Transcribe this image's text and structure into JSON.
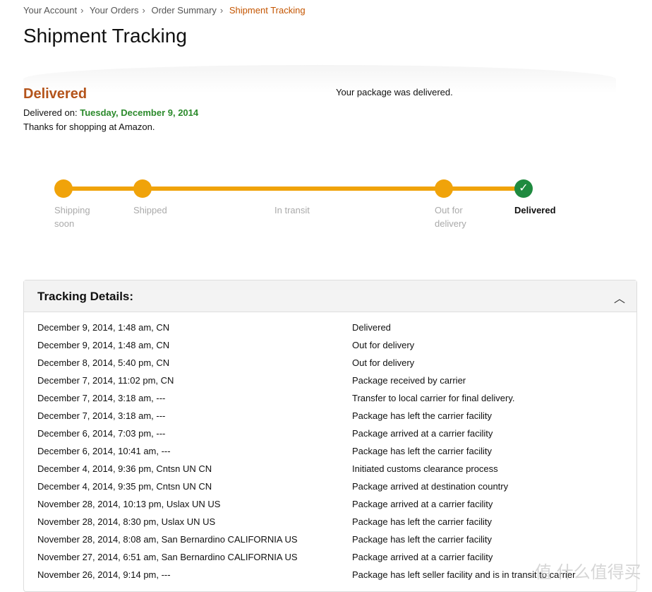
{
  "breadcrumb": [
    "Your Account",
    "Your Orders",
    "Order Summary",
    "Shipment Tracking"
  ],
  "title": "Shipment Tracking",
  "status": {
    "heading": "Delivered",
    "delivered_on_label": "Delivered on:",
    "delivered_date": "Tuesday, December 9, 2014",
    "thanks": "Thanks for shopping at Amazon.",
    "message": "Your package was delivered."
  },
  "progress": {
    "steps": [
      {
        "label": "Shipping soon",
        "dot": true,
        "current": false
      },
      {
        "label": "Shipped",
        "dot": true,
        "current": false
      },
      {
        "label": "In transit",
        "dot": false,
        "current": false
      },
      {
        "label": "Out for delivery",
        "dot": true,
        "current": false
      },
      {
        "label": "Delivered",
        "dot": true,
        "current": true
      }
    ],
    "color": "#f0a30a",
    "done_color": "#1f8a3f"
  },
  "tracking": {
    "title": "Tracking Details:",
    "rows": [
      [
        "December 9, 2014, 1:48 am,   CN",
        "Delivered"
      ],
      [
        "December 9, 2014, 1:48 am,   CN",
        "Out for delivery"
      ],
      [
        "December 8, 2014, 5:40 pm,   CN",
        "Out for delivery"
      ],
      [
        "December 7, 2014, 11:02 pm,   CN",
        "Package received by carrier"
      ],
      [
        "December 7, 2014, 3:18 am, ---",
        "Transfer to local carrier for final delivery."
      ],
      [
        "December 7, 2014, 3:18 am, ---",
        "Package has left the carrier facility"
      ],
      [
        "December 6, 2014, 7:03 pm, ---",
        "Package arrived at a carrier facility"
      ],
      [
        "December 6, 2014, 10:41 am, ---",
        "Package has left the carrier facility"
      ],
      [
        "December 4, 2014, 9:36 pm, Cntsn UN CN",
        "Initiated customs clearance process"
      ],
      [
        "December 4, 2014, 9:35 pm, Cntsn UN CN",
        "Package arrived at destination country"
      ],
      [
        "November 28, 2014, 10:13 pm, Uslax UN US",
        "Package arrived at a carrier facility"
      ],
      [
        "November 28, 2014, 8:30 pm, Uslax UN US",
        "Package has left the carrier facility"
      ],
      [
        "November 28, 2014, 8:08 am, San Bernardino CALIFORNIA US",
        "Package has left the carrier facility"
      ],
      [
        "November 27, 2014, 6:51 am, San Bernardino CALIFORNIA US",
        "Package arrived at a carrier facility"
      ],
      [
        "November 26, 2014, 9:14 pm, ---",
        "Package has left seller facility and is in transit to carrier"
      ]
    ]
  },
  "watermark": "值 什么值得买"
}
